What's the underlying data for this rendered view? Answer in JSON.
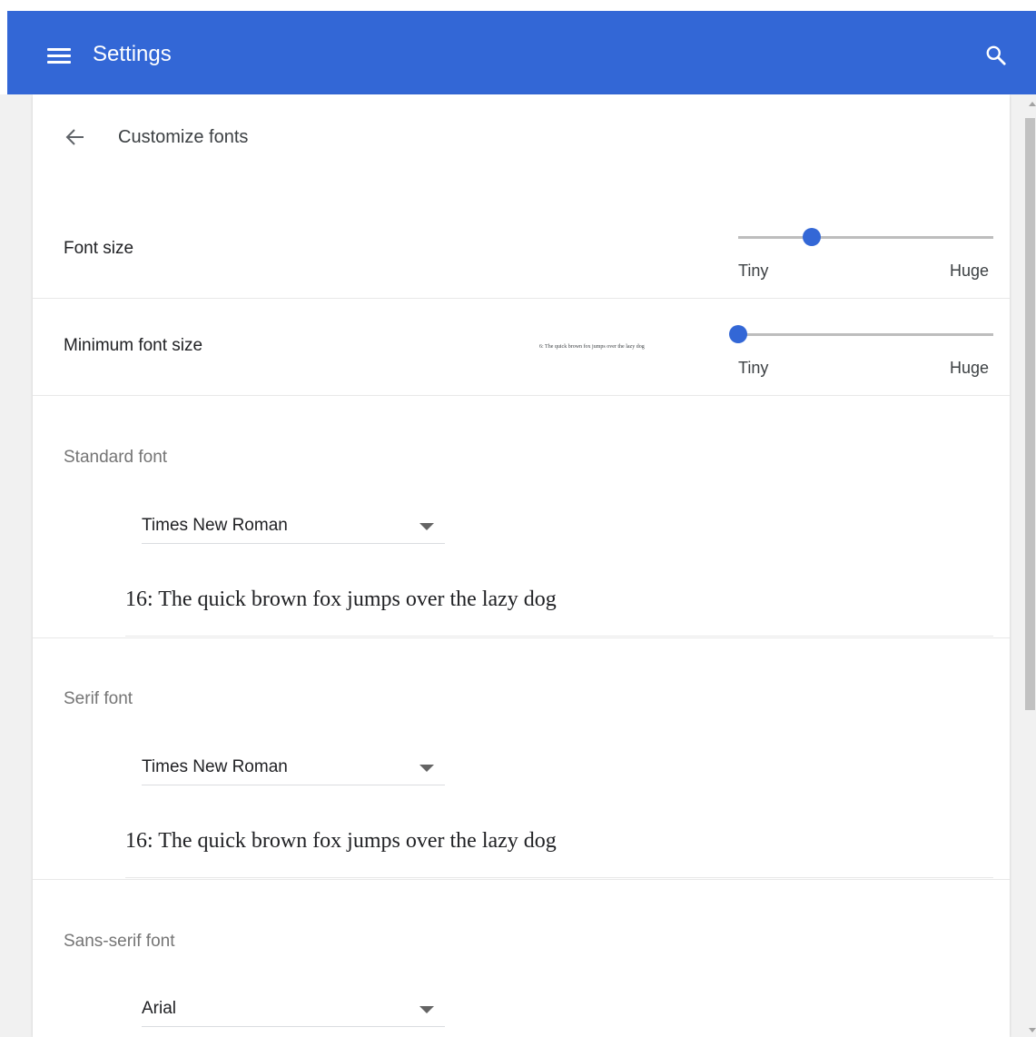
{
  "topbar": {
    "title": "Settings",
    "menu_icon": "menu-icon",
    "search_icon": "search-icon",
    "color": "#3367d6"
  },
  "page": {
    "title": "Customize fonts",
    "back_icon": "arrow-back-icon"
  },
  "font_size": {
    "label": "Font size",
    "min_label": "Tiny",
    "max_label": "Huge",
    "level_fraction": 0.29
  },
  "minimum_font_size": {
    "label": "Minimum font size",
    "sample": "6: The quick brown fox jumps over the lazy dog",
    "min_label": "Tiny",
    "max_label": "Huge",
    "level_fraction": 0.0
  },
  "standard_font": {
    "label": "Standard font",
    "selected": "Times New Roman",
    "sample": "16: The quick brown fox jumps over the lazy dog"
  },
  "serif_font": {
    "label": "Serif font",
    "selected": "Times New Roman",
    "sample": "16: The quick brown fox jumps over the lazy dog"
  },
  "sans_serif_font": {
    "label": "Sans-serif font",
    "selected": "Arial"
  }
}
